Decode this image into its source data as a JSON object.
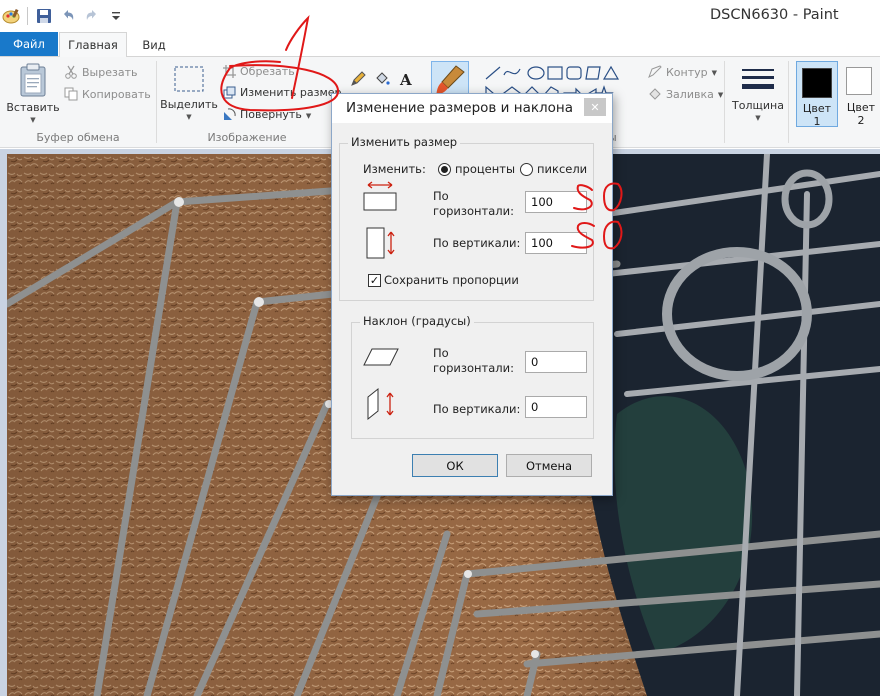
{
  "window": {
    "title": "DSCN6630 - Paint"
  },
  "tabs": {
    "file": "Файл",
    "home": "Главная",
    "view": "Вид"
  },
  "ribbon": {
    "clipboard": {
      "label": "Буфер обмена",
      "paste": "Вставить",
      "cut": "Вырезать",
      "copy": "Копировать"
    },
    "image": {
      "label": "Изображение",
      "select": "Выделить",
      "crop": "Обрезать",
      "resize": "Изменить размер",
      "rotate": "Повернуть"
    },
    "shapes": {
      "label": "ы",
      "outline": "Контур",
      "fill": "Заливка"
    },
    "size": {
      "label": "Толщина"
    },
    "colors": {
      "color1": "Цвет",
      "color1_num": "1",
      "color2": "Цвет",
      "color2_num": "2",
      "color1_value": "#000000",
      "color2_value": "#ffffff"
    }
  },
  "dialog": {
    "title": "Изменение размеров и наклона",
    "resize": {
      "legend": "Изменить размер",
      "by": "Изменить:",
      "percent": "проценты",
      "pixels": "пиксели",
      "horizontal_1": "По",
      "horizontal_2": "горизонтали:",
      "horizontal_value": "100",
      "vertical": "По вертикали:",
      "vertical_value": "100",
      "keep_ratio": "Сохранить пропорции"
    },
    "skew": {
      "legend": "Наклон (градусы)",
      "horizontal_1": "По",
      "horizontal_2": "горизонтали:",
      "horizontal_value": "0",
      "vertical": "По вертикали:",
      "vertical_value": "0"
    },
    "ok": "ОК",
    "cancel": "Отмена"
  },
  "annotations": {
    "step_number": "1",
    "target_value": "50"
  }
}
